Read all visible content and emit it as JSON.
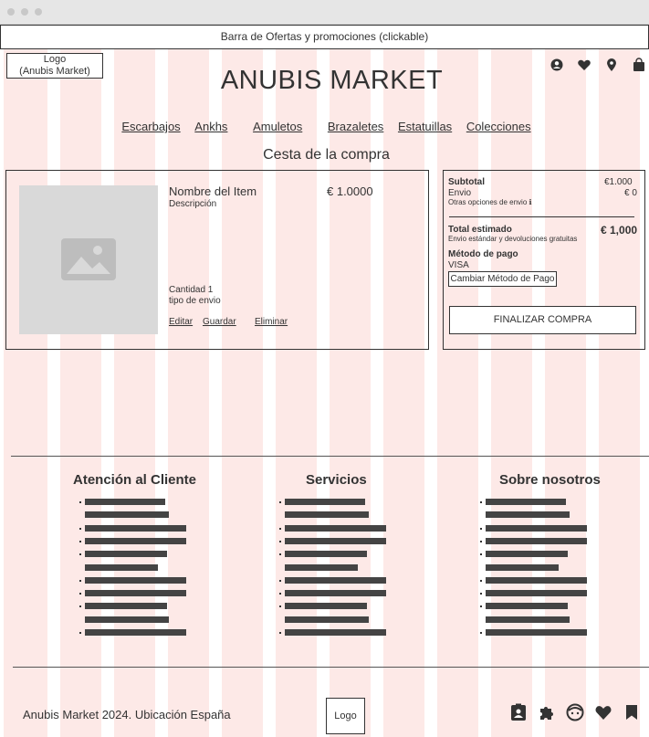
{
  "promo_bar": "Barra de Ofertas y promociones (clickable)",
  "header": {
    "logo_line1": "Logo",
    "logo_line2": "(Anubis Market)",
    "brand": "ANUBIS MARKET",
    "icons": [
      "user-icon",
      "heart-icon",
      "location-icon",
      "bag-icon"
    ]
  },
  "nav": [
    "Escarbajos",
    "Ankhs",
    "Amuletos",
    "Brazaletes",
    "Estatuillas",
    "Colecciones"
  ],
  "cart": {
    "title": "Cesta de la compra",
    "item": {
      "name": "Nombre del Item",
      "description": "Descripción",
      "price": "€ 1.0000",
      "quantity": "Cantidad 1",
      "shipping": "tipo de envio",
      "edit": "Editar",
      "save": "Guardar",
      "remove": "Eliminar"
    }
  },
  "summary": {
    "subtotal_label": "Subtotal",
    "subtotal_value": "€1.000",
    "shipping_label": "Envio",
    "shipping_value": "€ 0",
    "other_options": "Otras opciones de envio",
    "total_label": "Total estimado",
    "total_value": "€ 1,000",
    "total_note": "Envio estándar y devoluciones gratuitas",
    "payment_label": "Método de pago",
    "payment_value": "VISA",
    "change_payment": "Cambiar Método de Pago",
    "checkout": "FINALIZAR COMPRA"
  },
  "footer": {
    "columns": [
      {
        "title": "Atención al Cliente",
        "placeholder_lines": 11
      },
      {
        "title": "Servicios",
        "placeholder_lines": 11
      },
      {
        "title": "Sobre nosotros",
        "placeholder_lines": 11
      }
    ],
    "copyright": "Anubis Market 2024. Ubicación España",
    "logo": "Logo",
    "icons": [
      "contact-icon",
      "puzzle-icon",
      "face-icon",
      "heart-icon",
      "bookmark-icon"
    ]
  }
}
